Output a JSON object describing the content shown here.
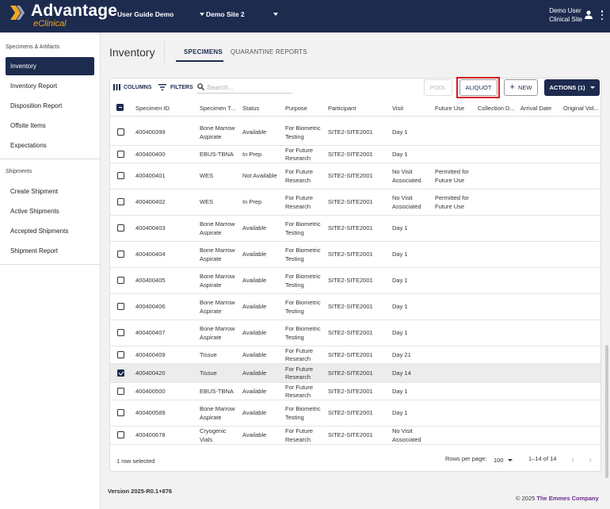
{
  "header": {
    "logo_title": "Advantage",
    "logo_subtitle": "eClinical",
    "study_select": "User Guide Demo",
    "site_select": "Demo Site 2",
    "user_name": "Demo User",
    "user_site": "Clinical Site"
  },
  "sidebar": {
    "section1": "Specimens & Artifacts",
    "items1": [
      "Inventory",
      "Inventory Report",
      "Disposition Report",
      "Offsite Items",
      "Expectations"
    ],
    "section2": "Shipments",
    "items2": [
      "Create Shipment",
      "Active Shipments",
      "Accepted Shipments",
      "Shipment Report"
    ]
  },
  "main": {
    "title": "Inventory",
    "tabs": [
      "SPECIMENS",
      "QUARANTINE REPORTS"
    ],
    "toolbar": {
      "columns": "COLUMNS",
      "filters": "FILTERS",
      "search_placeholder": "Search...",
      "pool": "POOL",
      "aliquot": "ALIQUOT",
      "new": "NEW",
      "actions": "ACTIONS (1)"
    },
    "columns": [
      "Specimen ID",
      "Specimen T...",
      "Status",
      "Purpose",
      "Participant",
      "Visit",
      "Future Use",
      "Collection D...",
      "Arrival Date",
      "Original Vol..."
    ],
    "rows": [
      {
        "id": "400400399",
        "type": "Bone Marrow Aspirate",
        "status": "Available",
        "purpose": "For Biometric Testing",
        "participant": "SITE2-SITE2001",
        "visit": "Day 1",
        "future": "",
        "checked": false
      },
      {
        "id": "400400400",
        "type": "EBUS-TBNA",
        "status": "In Prep",
        "purpose": "For Future Research",
        "participant": "SITE2-SITE2001",
        "visit": "Day 1",
        "future": "",
        "checked": false
      },
      {
        "id": "400400401",
        "type": "WES",
        "status": "Not Available",
        "purpose": "For Future Research",
        "participant": "SITE2-SITE2001",
        "visit": "No Visit Associated",
        "future": "Permitted for Future Use",
        "checked": false
      },
      {
        "id": "400400402",
        "type": "WES",
        "status": "In Prep",
        "purpose": "For Future Research",
        "participant": "SITE2-SITE2001",
        "visit": "No Visit Associated",
        "future": "Permitted for Future Use",
        "checked": false
      },
      {
        "id": "400400403",
        "type": "Bone Marrow Aspirate",
        "status": "Available",
        "purpose": "For Biometric Testing",
        "participant": "SITE2-SITE2001",
        "visit": "Day 1",
        "future": "",
        "checked": false
      },
      {
        "id": "400400404",
        "type": "Bone Marrow Aspirate",
        "status": "Available",
        "purpose": "For Biometric Testing",
        "participant": "SITE2-SITE2001",
        "visit": "Day 1",
        "future": "",
        "checked": false
      },
      {
        "id": "400400405",
        "type": "Bone Marrow Aspirate",
        "status": "Available",
        "purpose": "For Biometric Testing",
        "participant": "SITE2-SITE2001",
        "visit": "Day 1",
        "future": "",
        "checked": false
      },
      {
        "id": "400400406",
        "type": "Bone Marrow Aspirate",
        "status": "Available",
        "purpose": "For Biometric Testing",
        "participant": "SITE2-SITE2001",
        "visit": "Day 1",
        "future": "",
        "checked": false
      },
      {
        "id": "400400407",
        "type": "Bone Marrow Aspirate",
        "status": "Available",
        "purpose": "For Biometric Testing",
        "participant": "SITE2-SITE2001",
        "visit": "Day 1",
        "future": "",
        "checked": false
      },
      {
        "id": "400400409",
        "type": "Tissue",
        "status": "Available",
        "purpose": "For Future Research",
        "participant": "SITE2-SITE2001",
        "visit": "Day 21",
        "future": "",
        "checked": false
      },
      {
        "id": "400400420",
        "type": "Tissue",
        "status": "Available",
        "purpose": "For Future Research",
        "participant": "SITE2-SITE2001",
        "visit": "Day 14",
        "future": "",
        "checked": true
      },
      {
        "id": "400400500",
        "type": "EBUS-TBNA",
        "status": "Available",
        "purpose": "For Future Research",
        "participant": "SITE2-SITE2001",
        "visit": "Day 1",
        "future": "",
        "checked": false
      },
      {
        "id": "400400589",
        "type": "Bone Marrow Aspirate",
        "status": "Available",
        "purpose": "For Biometric Testing",
        "participant": "SITE2-SITE2001",
        "visit": "Day 1",
        "future": "",
        "checked": false
      },
      {
        "id": "400400678",
        "type": "Cryogenic Vials",
        "status": "Available",
        "purpose": "For Future Research",
        "participant": "SITE2-SITE2001",
        "visit": "No Visit Associated",
        "future": "",
        "checked": false
      }
    ],
    "footer": {
      "selected": "1 row selected",
      "rows_per_page_label": "Rows per page:",
      "rows_per_page": "100",
      "range": "1–14 of 14"
    }
  },
  "page_footer": {
    "version": "Version 2025-R0.1+876",
    "copyright_prefix": "© 2025",
    "company": "The Emmes Company"
  },
  "colors": {
    "navy": "#1d2b4f",
    "accent_orange": "#f5a623",
    "highlight_red": "#d71920",
    "company_purple": "#6a2c91"
  }
}
